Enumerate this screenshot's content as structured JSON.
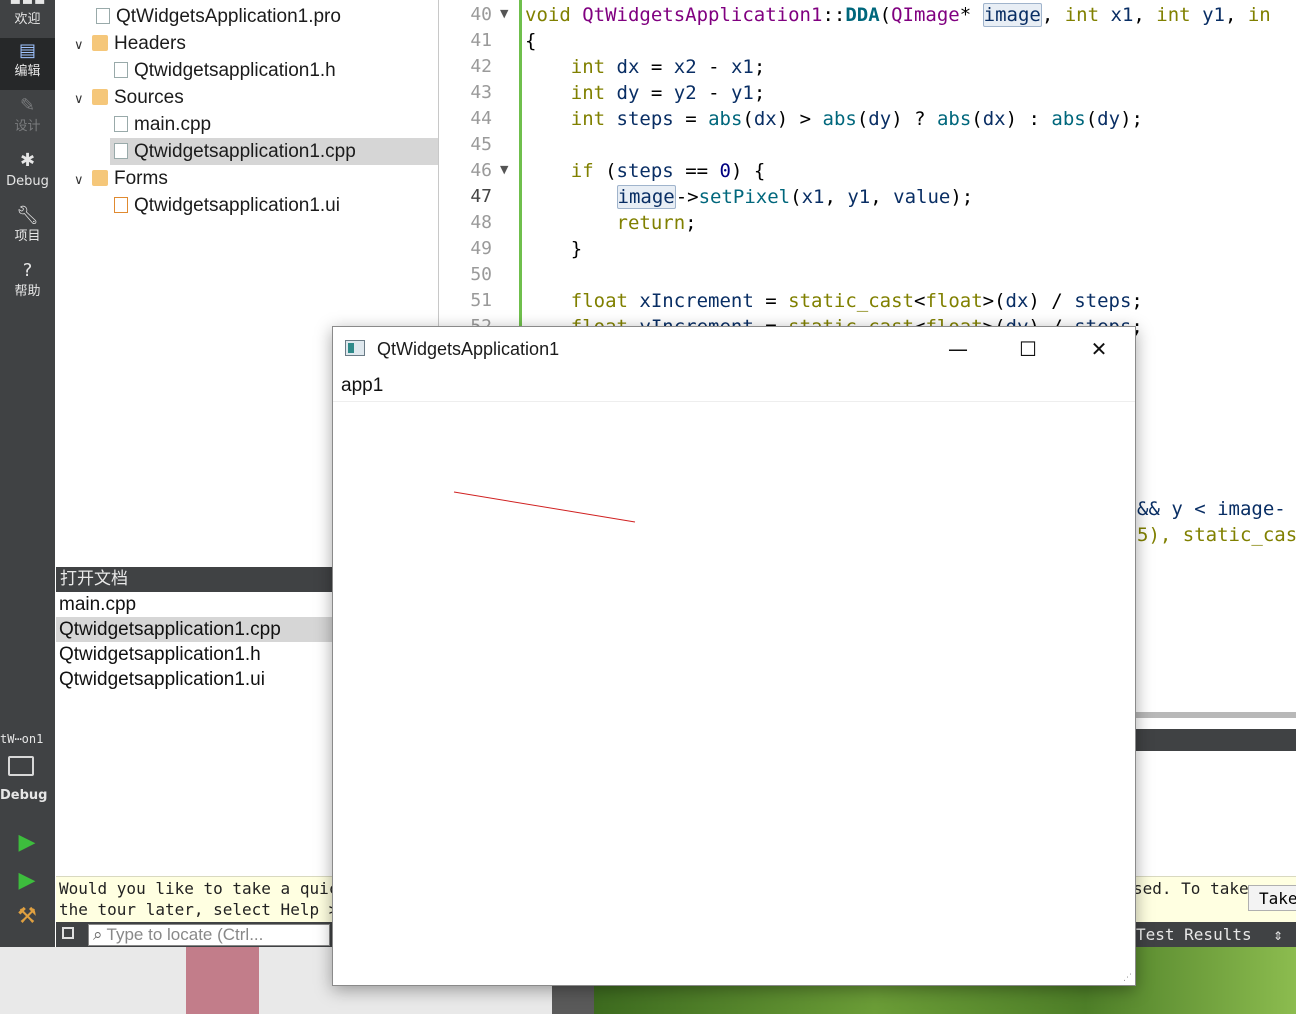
{
  "modebar": {
    "items": [
      {
        "label": "欢迎",
        "icon": "grid-icon"
      },
      {
        "label": "编辑",
        "icon": "edit-document-icon"
      },
      {
        "label": "设计",
        "icon": "pencil-icon"
      },
      {
        "label": "Debug",
        "icon": "bug-icon"
      },
      {
        "label": "项目",
        "icon": "wrench-icon"
      },
      {
        "label": "帮助",
        "icon": "help-icon"
      }
    ],
    "kit_label": "tW⋯on1",
    "kit_mode": "Debug"
  },
  "project_tree": {
    "rows": [
      {
        "label": "QtWidgetsApplication1.pro",
        "type": "file"
      },
      {
        "label": "Headers",
        "type": "folder"
      },
      {
        "label": "Qtwidgetsapplication1.h",
        "type": "file"
      },
      {
        "label": "Sources",
        "type": "folder"
      },
      {
        "label": "main.cpp",
        "type": "file"
      },
      {
        "label": "Qtwidgetsapplication1.cpp",
        "type": "file",
        "selected": true
      },
      {
        "label": "Forms",
        "type": "folder"
      },
      {
        "label": "Qtwidgetsapplication1.ui",
        "type": "file"
      }
    ]
  },
  "open_documents": {
    "title": "打开文档",
    "items": [
      "main.cpp",
      "Qtwidgetsapplication1.cpp",
      "Qtwidgetsapplication1.h",
      "Qtwidgetsapplication1.ui"
    ],
    "selected_index": 1
  },
  "editor": {
    "line_numbers": [
      "40",
      "41",
      "42",
      "43",
      "44",
      "45",
      "46",
      "47",
      "48",
      "49",
      "50",
      "51",
      "52"
    ],
    "current_line": "47",
    "right_fragments": {
      "line_51_tail": "&& y < image-",
      "line_52_tail": "5), static_cas"
    }
  },
  "welcome": {
    "line1": "Would you like to take a quick",
    "line2": "the tour later, select Help > U",
    "line1_right": "sed. To take",
    "button": "Take"
  },
  "statusbar": {
    "locator_placeholder": "Type to locate (Ctrl...",
    "test_results": "Test Results"
  },
  "app_window": {
    "title": "QtWidgetsApplication1",
    "menu_item": "app1",
    "line_color": "#d02020"
  }
}
